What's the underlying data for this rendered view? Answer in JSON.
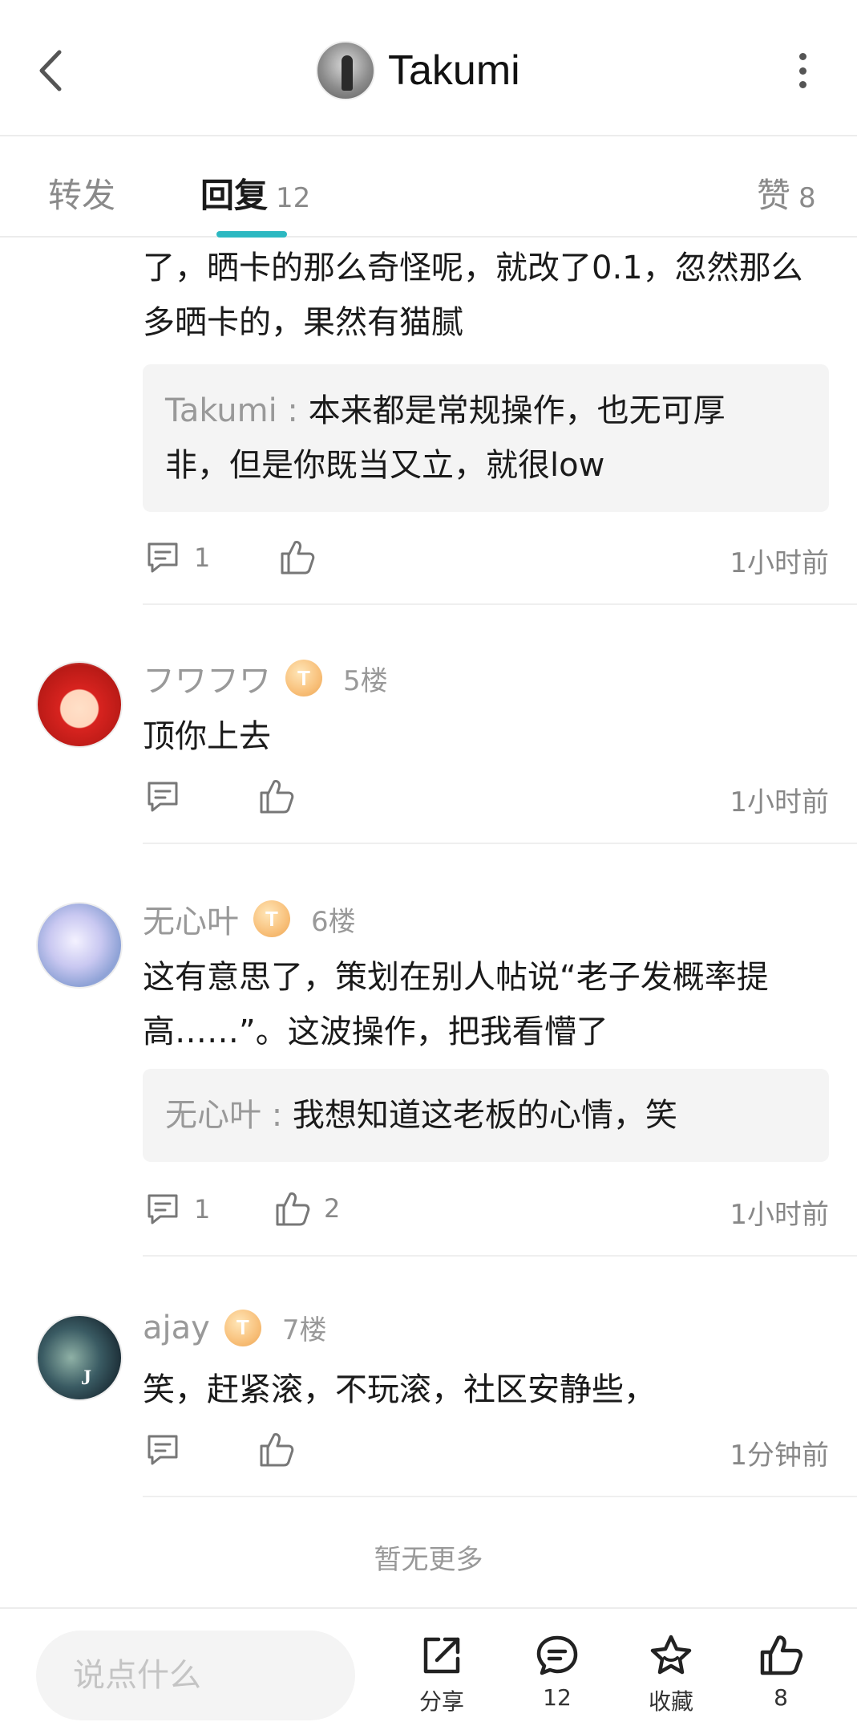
{
  "header": {
    "title": "Takumi",
    "back_icon": "chevron-left-icon",
    "more_icon": "more-vertical-icon"
  },
  "tabs": [
    {
      "label": "转发",
      "count": ""
    },
    {
      "label": "回复",
      "count": "12"
    },
    {
      "label": "赞",
      "count": "8"
    }
  ],
  "comments": {
    "partial": {
      "text_lines": [
        "了，晒卡的那么奇怪呢，就改了0.1，忽然那么",
        "多晒卡的，果然有猫腻"
      ],
      "reply": {
        "name": "Takumi",
        "sep": " : ",
        "text_lines": [
          "本来都是常规操作，也无可厚",
          "非，但是你既当又立，就很low"
        ]
      },
      "reply_count": "1",
      "time": "1小时前"
    },
    "c5": {
      "username": "フワフワ",
      "badge": "T",
      "floor": "5楼",
      "text": "顶你上去",
      "reply_count": "",
      "like_count": "",
      "time": "1小时前"
    },
    "c6": {
      "username": "无心叶",
      "badge": "T",
      "floor": "6楼",
      "text_lines": [
        "这有意思了，策划在别人帖说“老子发概率提",
        "高……”。这波操作，把我看懵了"
      ],
      "reply": {
        "name": "无心叶",
        "sep": " : ",
        "text": "我想知道这老板的心情，笑"
      },
      "reply_count": "1",
      "like_count": "2",
      "time": "1小时前"
    },
    "c7": {
      "username": "ajay",
      "badge": "T",
      "floor": "7楼",
      "avatar_letter": "J",
      "text": "笑，赶紧滚，不玩滚，社区安静些，",
      "reply_count": "",
      "like_count": "",
      "time": "1分钟前"
    }
  },
  "no_more": "暂无更多",
  "bottom": {
    "input_placeholder": "说点什么",
    "share_label": "分享",
    "comment_count": "12",
    "collect_label": "收藏",
    "like_count": "8"
  },
  "colors": {
    "accent": "#2cb8c1",
    "badge": "#f5b56a",
    "muted_text": "#999999"
  }
}
